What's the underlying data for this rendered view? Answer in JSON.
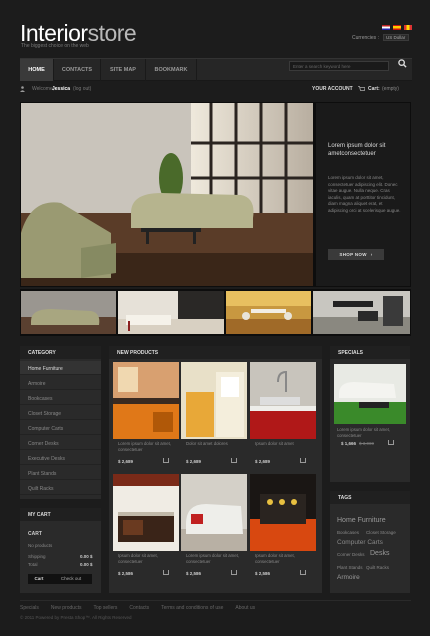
{
  "header": {
    "logo_bold": "Interior",
    "logo_light": "store",
    "tagline": "The biggest choice on the web",
    "currency_label": "Currencies :",
    "currency_value": "US Dollar"
  },
  "nav": {
    "items": [
      "HOME",
      "CONTACTS",
      "SITE MAP",
      "BOOKMARK"
    ],
    "search_placeholder": "Enter a search keyword here"
  },
  "userbar": {
    "welcome": "Welcome,",
    "user": "Jessica",
    "logout": "(log out)",
    "account": "YOUR ACCOUNT",
    "cart_label": "Cart:",
    "cart_value": "(empty)"
  },
  "hero": {
    "title": "Lorem ipsum dolor sit ametconsectetuer",
    "text": "Lorem ipsum dolor sit amet, consectetuer adipiscing elit. Donec vitae augue. Nulla neque. Cras iaculis, quam at porttitor tincidunt, diam magna aliquet erat, et adipiscing orci at scelerisque augue.",
    "button": "SHOP NOW"
  },
  "category": {
    "title": "CATEGORY",
    "items": [
      "Home Furniture",
      "Armoire",
      "Bookcases",
      "Closet Storage",
      "Computer Carts",
      "Corner Desks",
      "Executive Desks",
      "Plant Stands",
      "Quilt Racks"
    ]
  },
  "mycart": {
    "title": "MY CART",
    "cart_label": "CART",
    "no_products": "No products",
    "shipping_label": "Shipping",
    "shipping_value": "0.00 $",
    "total_label": "Total",
    "total_value": "0.00 $",
    "cart_button": "Cart",
    "checkout_button": "Check out"
  },
  "new_products": {
    "title": "NEW PRODUCTS",
    "items": [
      {
        "desc": "Lorem ipsum dolor sit amet, consectetuer",
        "price": "$ 2,689"
      },
      {
        "desc": "Dolor sit amet dolores",
        "price": "$ 2,689"
      },
      {
        "desc": "Ipsum dolor sit amet",
        "price": "$ 2,689"
      },
      {
        "desc": "Ipsum dolor sit amet, consectetuer",
        "price": "$ 2,586"
      },
      {
        "desc": "Lorem ipsum dolor sit amet, consectetuer",
        "price": "$ 2,586"
      },
      {
        "desc": "Ipsum dolor sit amet, consectetuer",
        "price": "$ 2,586"
      }
    ]
  },
  "specials": {
    "title": "SPECIALS",
    "desc": "Lorem ipsum dolor sit amet, consectetuer",
    "price": "$ 1,666",
    "old_price": "$ 3,000"
  },
  "tags": {
    "title": "TAGS",
    "items": [
      "Home Furniture",
      "Bookcases",
      "Closet Storage",
      "Computer Carts",
      "Corner Desks",
      "Desks",
      "Plant Stands",
      "Quilt Racks",
      "Armoire"
    ]
  },
  "footer": {
    "links": [
      "Specials",
      "New products",
      "Top sellers",
      "Contacts",
      "Terms and conditions of use",
      "About us"
    ],
    "copyright": "© 2011 Powered by Presta Shop™. All Rights Reserved"
  },
  "colors": {
    "background": "#1c1c1c",
    "panel": "#2a2a2a",
    "accent": "#ffffff"
  }
}
